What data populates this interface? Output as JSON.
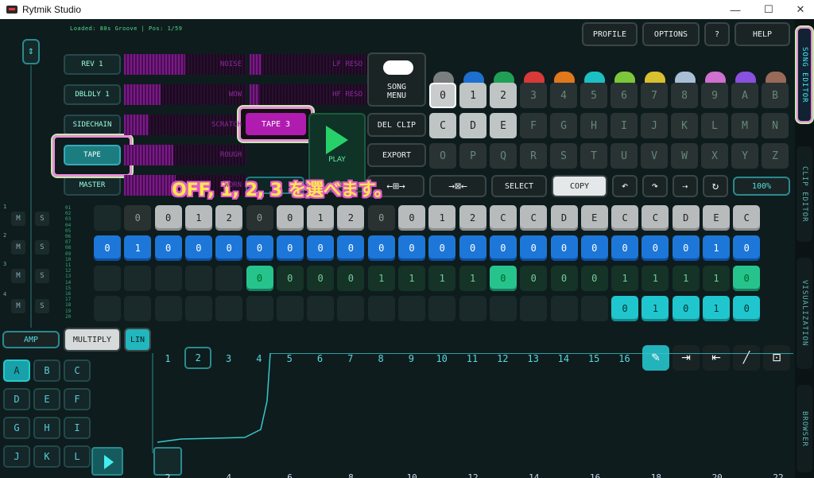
{
  "window": {
    "title": "Rytmik Studio",
    "minimize": "—",
    "maximize": "☐",
    "close": "✕"
  },
  "status": "Loaded: 80s Groove | Pos: 1/59",
  "top_buttons": {
    "profile": "PROFILE",
    "options": "OPTIONS",
    "help_q": "?",
    "help": "HELP"
  },
  "side_tabs": [
    "SONG EDITOR",
    "CLIP EDITOR",
    "VISUALIZATION",
    "BROWSER"
  ],
  "fx_buttons": [
    "REV 1",
    "DBLDLY 1",
    "SIDECHAIN",
    "TAPE",
    "MASTER"
  ],
  "fx_bars": [
    "NOISE",
    "LF RESO",
    "WOW",
    "HF RESO",
    "SCRATCH",
    "ROUGH",
    "WORN"
  ],
  "tape_popup": "TAPE 3",
  "song_menu": [
    "SONG",
    "MENU"
  ],
  "del_clip": "DEL CLIP",
  "export": "EXPORT",
  "play_live": {
    "play": "PLAY",
    "live": "LIVE"
  },
  "pick_colors": [
    "#7a7e7e",
    "#1d6fd0",
    "#1fa055",
    "#d83a3a",
    "#e0781c",
    "#1cc0c4",
    "#7dc83a",
    "#d8c030",
    "#a9bfd8",
    "#d070d0",
    "#8a50e0",
    "#9a6a58"
  ],
  "pattern_keys": [
    "0",
    "1",
    "2",
    "3",
    "4",
    "5",
    "6",
    "7",
    "8",
    "9",
    "A",
    "B",
    "C",
    "D",
    "E",
    "F",
    "G",
    "H",
    "I",
    "J",
    "K",
    "L",
    "M",
    "N",
    "O",
    "P",
    "Q",
    "R",
    "S",
    "T",
    "U",
    "V",
    "W",
    "X",
    "Y",
    "Z"
  ],
  "edit_buttons": {
    "select": "SELECT",
    "copy": "COPY",
    "zoom": "100%"
  },
  "track_labels": [
    "1",
    "2",
    "3",
    "4"
  ],
  "mute_solo": [
    "M",
    "S"
  ],
  "row_numbers": [
    "01",
    "02",
    "03",
    "04",
    "05",
    "06",
    "07",
    "08",
    "09",
    "10",
    "11",
    "12",
    "13",
    "14",
    "15",
    "16",
    "17",
    "18",
    "19",
    "20"
  ],
  "tracks": {
    "row1": [
      "",
      "0",
      "0",
      "1",
      "2",
      "0",
      "0",
      "1",
      "2",
      "0",
      "0",
      "1",
      "2",
      "C",
      "C",
      "D",
      "E",
      "C",
      "C",
      "D",
      "E",
      "C"
    ],
    "row2": [
      "0",
      "1",
      "0",
      "0",
      "0",
      "0",
      "0",
      "0",
      "0",
      "0",
      "0",
      "0",
      "0",
      "0",
      "0",
      "0",
      "0",
      "0",
      "0",
      "0",
      "1",
      "0"
    ],
    "row3": [
      "",
      "",
      "",
      "",
      "",
      "0",
      "0",
      "0",
      "0",
      "1",
      "1",
      "1",
      "1",
      "0",
      "0",
      "0",
      "0",
      "1",
      "1",
      "1",
      "1",
      "0"
    ],
    "row4": [
      "",
      "",
      "",
      "",
      "",
      "",
      "",
      "",
      "",
      "",
      "",
      "",
      "",
      "",
      "",
      "",
      "",
      "0",
      "1",
      "0",
      "1",
      "0"
    ]
  },
  "controls": {
    "amp": "AMP",
    "multiply": "MULTIPLY",
    "lin": "LIN"
  },
  "step_numbers": [
    "1",
    "2",
    "3",
    "4",
    "5",
    "6",
    "7",
    "8",
    "9",
    "10",
    "11",
    "12",
    "13",
    "14",
    "15",
    "16"
  ],
  "clip_buttons": [
    "A",
    "B",
    "C",
    "D",
    "E",
    "F",
    "G",
    "H",
    "I",
    "J",
    "K",
    "L"
  ],
  "ruler": [
    "2",
    "4",
    "6",
    "8",
    "10",
    "12",
    "14",
    "16",
    "18",
    "20",
    "22"
  ],
  "annotation": "OFF, 1, 2, 3 を選べます。"
}
